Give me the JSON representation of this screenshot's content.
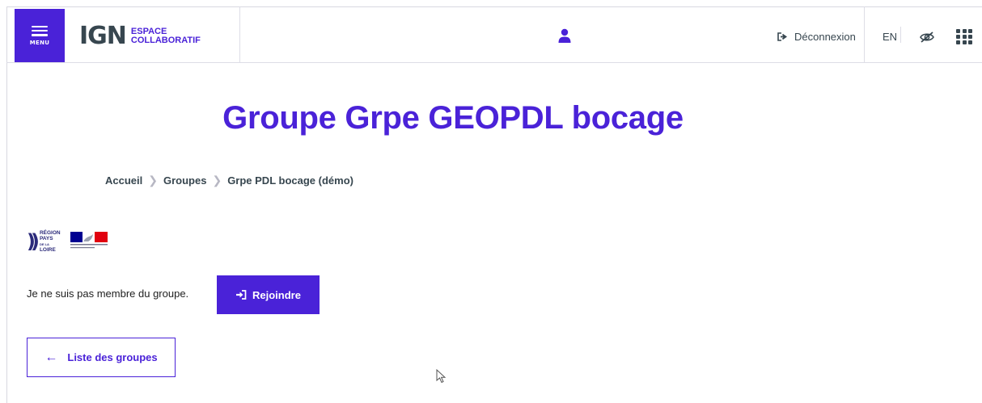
{
  "header": {
    "menu_label": "MENU",
    "logo_main": "IGN",
    "logo_line1": "ESPACE",
    "logo_line2": "COLLABORATIF",
    "logout_label": "Déconnexion",
    "lang_label": "EN",
    "accent_color": "#4a22d8"
  },
  "page": {
    "title": "Groupe Grpe GEOPDL bocage"
  },
  "breadcrumb": {
    "items": [
      "Accueil",
      "Groupes",
      "Grpe PDL bocage (démo)"
    ]
  },
  "logos": {
    "region_line1": "RÉGION",
    "region_line2": "PAYS",
    "region_line3": "DE LA",
    "region_line4": "LOIRE"
  },
  "membership": {
    "status_text": "Je ne suis pas membre du groupe.",
    "join_label": "Rejoindre"
  },
  "back": {
    "label": "Liste des groupes"
  }
}
